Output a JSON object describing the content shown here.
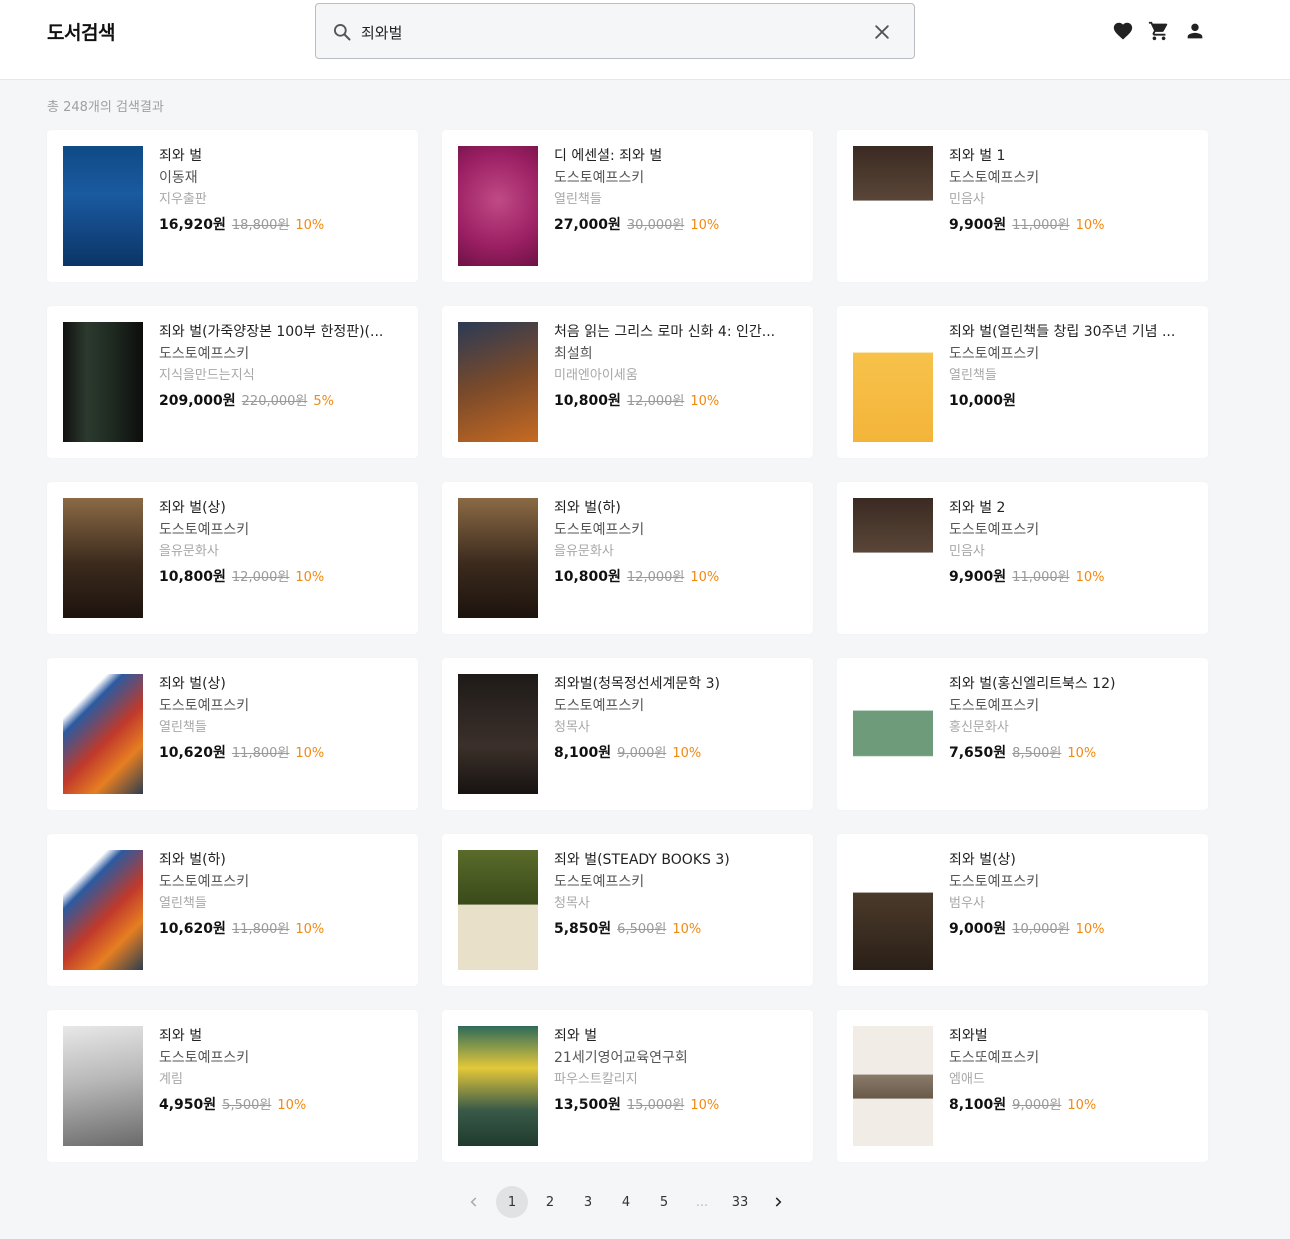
{
  "header": {
    "logo": "도서검색",
    "search_value": "죄와벌",
    "icons": [
      "heart-icon",
      "cart-icon",
      "account-icon"
    ]
  },
  "results": {
    "count_text": "총 248개의 검색결과"
  },
  "books": [
    {
      "title": "죄와 벌",
      "author": "이동재",
      "publisher": "지우출판",
      "price": "16,920원",
      "original": "18,800원",
      "discount": "10%",
      "cover": "cover-1"
    },
    {
      "title": "디 에센셜: 죄와 벌",
      "author": "도스토예프스키",
      "publisher": "열린책들",
      "price": "27,000원",
      "original": "30,000원",
      "discount": "10%",
      "cover": "cover-2"
    },
    {
      "title": "죄와 벌 1",
      "author": "도스토예프스키",
      "publisher": "민음사",
      "price": "9,900원",
      "original": "11,000원",
      "discount": "10%",
      "cover": "cover-3"
    },
    {
      "title": "죄와 벌(가죽양장본 100부 한정판)(...",
      "author": "도스토예프스키",
      "publisher": "지식을만드는지식",
      "price": "209,000원",
      "original": "220,000원",
      "discount": "5%",
      "cover": "cover-4"
    },
    {
      "title": "처음 읽는 그리스 로마 신화 4: 인간...",
      "author": "최설희",
      "publisher": "미래엔아이세움",
      "price": "10,800원",
      "original": "12,000원",
      "discount": "10%",
      "cover": "cover-5"
    },
    {
      "title": "죄와 벌(열린책들 창립 30주년 기념 ...",
      "author": "도스토예프스키",
      "publisher": "열린책들",
      "price": "10,000원",
      "original": "",
      "discount": "",
      "cover": "cover-6"
    },
    {
      "title": "죄와 벌(상)",
      "author": "도스토예프스키",
      "publisher": "을유문화사",
      "price": "10,800원",
      "original": "12,000원",
      "discount": "10%",
      "cover": "cover-7"
    },
    {
      "title": "죄와 벌(하)",
      "author": "도스토예프스키",
      "publisher": "을유문화사",
      "price": "10,800원",
      "original": "12,000원",
      "discount": "10%",
      "cover": "cover-8"
    },
    {
      "title": "죄와 벌 2",
      "author": "도스토예프스키",
      "publisher": "민음사",
      "price": "9,900원",
      "original": "11,000원",
      "discount": "10%",
      "cover": "cover-9"
    },
    {
      "title": "죄와 벌(상)",
      "author": "도스토예프스키",
      "publisher": "열린책들",
      "price": "10,620원",
      "original": "11,800원",
      "discount": "10%",
      "cover": "cover-10"
    },
    {
      "title": "죄와벌(청목정선세계문학 3)",
      "author": "도스토예프스키",
      "publisher": "청목사",
      "price": "8,100원",
      "original": "9,000원",
      "discount": "10%",
      "cover": "cover-11"
    },
    {
      "title": "죄와 벌(홍신엘리트북스 12)",
      "author": "도스토예프스키",
      "publisher": "홍신문화사",
      "price": "7,650원",
      "original": "8,500원",
      "discount": "10%",
      "cover": "cover-12"
    },
    {
      "title": "죄와 벌(하)",
      "author": "도스토예프스키",
      "publisher": "열린책들",
      "price": "10,620원",
      "original": "11,800원",
      "discount": "10%",
      "cover": "cover-13"
    },
    {
      "title": "죄와 벌(STEADY BOOKS 3)",
      "author": "도스토예프스키",
      "publisher": "청목사",
      "price": "5,850원",
      "original": "6,500원",
      "discount": "10%",
      "cover": "cover-14"
    },
    {
      "title": "죄와 벌(상)",
      "author": "도스토예프스키",
      "publisher": "범우사",
      "price": "9,000원",
      "original": "10,000원",
      "discount": "10%",
      "cover": "cover-15"
    },
    {
      "title": "죄와 벌",
      "author": "도스토예프스키",
      "publisher": "계림",
      "price": "4,950원",
      "original": "5,500원",
      "discount": "10%",
      "cover": "cover-16"
    },
    {
      "title": "죄와 벌",
      "author": "21세기영어교육연구회",
      "publisher": "파우스트칼리지",
      "price": "13,500원",
      "original": "15,000원",
      "discount": "10%",
      "cover": "cover-17"
    },
    {
      "title": "죄와벌",
      "author": "도스또예프스키",
      "publisher": "엠애드",
      "price": "8,100원",
      "original": "9,000원",
      "discount": "10%",
      "cover": "cover-18"
    }
  ],
  "pagination": {
    "prev_icon": "chevron-left-icon",
    "pages": [
      "1",
      "2",
      "3",
      "4",
      "5",
      "...",
      "33"
    ],
    "current": "1",
    "next_icon": "chevron-right-icon"
  },
  "colors": {
    "discount": "#f08a12",
    "background": "#f5f6f8"
  }
}
